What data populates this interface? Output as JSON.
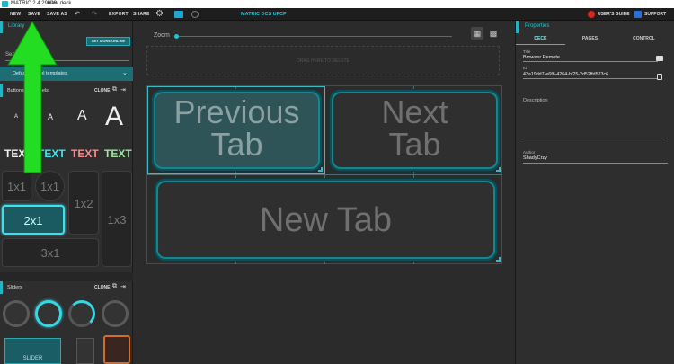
{
  "window": {
    "app_title": "MATRIC 2.4.29008",
    "deck_title": "New deck"
  },
  "toolbar": {
    "new": "NEW",
    "save": "SAVE",
    "save_as": "SAVE AS",
    "export": "EXPORT",
    "share": "SHARE",
    "center_title": "MATRIC DCS UFCP",
    "users_guide": "USER'S GUIDE",
    "support": "SUPPORT"
  },
  "library": {
    "title": "Library",
    "get_more": "GET MORE ONLINE",
    "search_label": "Search",
    "templates_label": "Default control templates",
    "buttons_section": "Buttons with labels",
    "clone": "CLONE",
    "font_samples": [
      "A",
      "A",
      "A",
      "A"
    ],
    "text_samples": [
      "TEXT",
      "TEXT",
      "TEXT",
      "TEXT"
    ],
    "tile_labels": [
      "1x1",
      "1x1",
      "1x2",
      "1x3",
      "2x1",
      "3x1"
    ],
    "sliders_section": "Sliders",
    "slider_label": "SLIDER"
  },
  "editor": {
    "zoom_label": "Zoom",
    "drop_hint": "DRAG HERE TO DELETE",
    "buttons": [
      {
        "line1": "Previous",
        "line2": "Tab"
      },
      {
        "line1": "Next",
        "line2": "Tab"
      },
      {
        "line1": "New Tab"
      }
    ]
  },
  "properties": {
    "title": "Properties",
    "tabs": [
      "DECK",
      "PAGES",
      "CONTROL"
    ],
    "active_tab": "DECK",
    "title_label": "Title",
    "title_value": "Browser Remote",
    "id_label": "Id",
    "id_value": "43a19dd7-e6f6-4264-bf25-2d52ffd523c6",
    "description_label": "Description",
    "author_label": "Author",
    "author_value": "ShadyCrzy"
  },
  "colors": {
    "accent": "#1fc6d4",
    "accent_dark": "#1d6d75",
    "arrow": "#22dd22",
    "red_badge": "#d9261c",
    "blue_badge": "#2b6fd6"
  }
}
